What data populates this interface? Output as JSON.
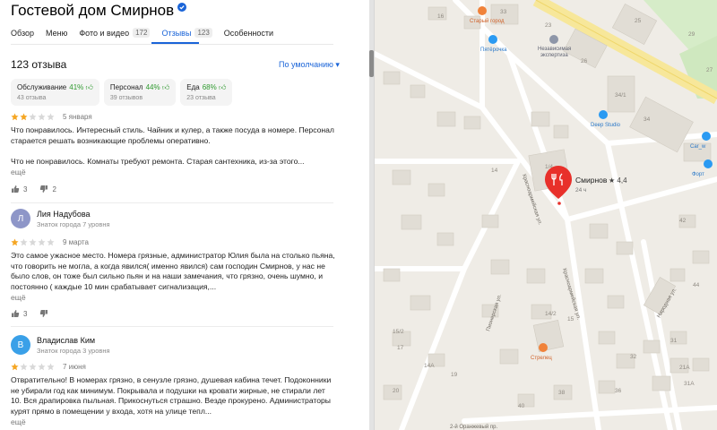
{
  "place": {
    "title": "Гостевой дом Смирнов"
  },
  "tabs": [
    {
      "label": "Обзор",
      "count": ""
    },
    {
      "label": "Меню",
      "count": ""
    },
    {
      "label": "Фото и видео",
      "count": "172"
    },
    {
      "label": "Отзывы",
      "count": "123"
    },
    {
      "label": "Особенности",
      "count": ""
    }
  ],
  "reviews_header": {
    "count_label": "123 отзыва",
    "sort_label": "По умолчанию ▾"
  },
  "aspects": [
    {
      "name": "Обслуживание",
      "percent": "41%",
      "count": "43 отзыва"
    },
    {
      "name": "Персонал",
      "percent": "44%",
      "count": "39 отзывов"
    },
    {
      "name": "Еда",
      "percent": "68%",
      "count": "23 отзыва"
    }
  ],
  "colors": {
    "accent": "#1a64d8",
    "positive": "#2f9a2f",
    "star_on": "#f5a623",
    "star_off": "#d8d8d8",
    "pin": "#e8302a"
  },
  "reviews": [
    {
      "rating": 2,
      "date": "5 января",
      "paragraphs": [
        "Что понравилось. Интересный стиль. Чайник и кулер, а также посуда в номере. Персонал старается решать возникающие проблемы оперативно.",
        "Что не понравилось. Комнаты требуют ремонта. Старая сантехника, из-за этого..."
      ],
      "more": "ещё",
      "likes": "3",
      "dislikes": "2"
    },
    {
      "author": "Лия Надубова",
      "initial": "Л",
      "avatar_color": "#8e96c8",
      "level": "Знаток города 7 уровня",
      "rating": 1,
      "date": "9 марта",
      "text": "Это самое ужасное место. Номера грязные, администратор Юлия была на столько пьяна, что говорить не могла, а когда явился( именно явился) сам господин Смирнов, у нас не было слов, он тоже был сильно пьян и на наши замечания, что грязно, очень шумно, и постоянно ( каждые 10 мин срабатывает сигнализация,...",
      "more": "ещё",
      "likes": "3",
      "dislikes": ""
    },
    {
      "author": "Владислав Ким",
      "initial": "В",
      "avatar_color": "#3aa0e8",
      "level": "Знаток города 3 уровня",
      "rating": 1,
      "date": "7 июня",
      "text": "Отвратительно! В номерах грязно, в сенузле грязно, душевая кабина течет. Подоконники не убирали год как минимум. Покрывала и подушки на кровати жирные, не стирали лет 10. Вся драпировка пыльная. Прикоснуться страшно. Везде прокурено. Администраторы курят прямо в помещении у входа, хотя на улице тепл...",
      "more": "ещё"
    }
  ],
  "map": {
    "pin": {
      "name": "Смирнов",
      "rating": "★ 4,4",
      "hours": "24 ч",
      "icon": "fork-knife-icon"
    },
    "pois": [
      {
        "name": "Старый город",
        "icon": "restaurant-icon"
      },
      {
        "name": "Пятёрочка",
        "icon": "shopping-bag-icon"
      },
      {
        "name": "Независимая экспертиза",
        "icon": "building-icon"
      },
      {
        "name": "Deep Studio",
        "icon": "shopping-bag-icon"
      },
      {
        "name": "Стрелец",
        "icon": "restaurant-icon"
      },
      {
        "name": "Car_w",
        "icon": "shopping-bag-icon"
      },
      {
        "name": "Форт",
        "icon": "shopping-bag-icon"
      }
    ],
    "streets": [
      "Красноармейская ул.",
      "Красноармейская ул.",
      "Пионерская ул.",
      "Народная ул.",
      "2-й Оранжевый пр."
    ],
    "house_numbers": [
      "16",
      "23",
      "25",
      "26",
      "27",
      "29",
      "33",
      "34",
      "34/1",
      "1/4",
      "14",
      "14А",
      "14/2",
      "15",
      "15/2",
      "17",
      "19",
      "20",
      "21А",
      "31",
      "31А",
      "32",
      "36",
      "38",
      "40",
      "42",
      "44"
    ]
  }
}
